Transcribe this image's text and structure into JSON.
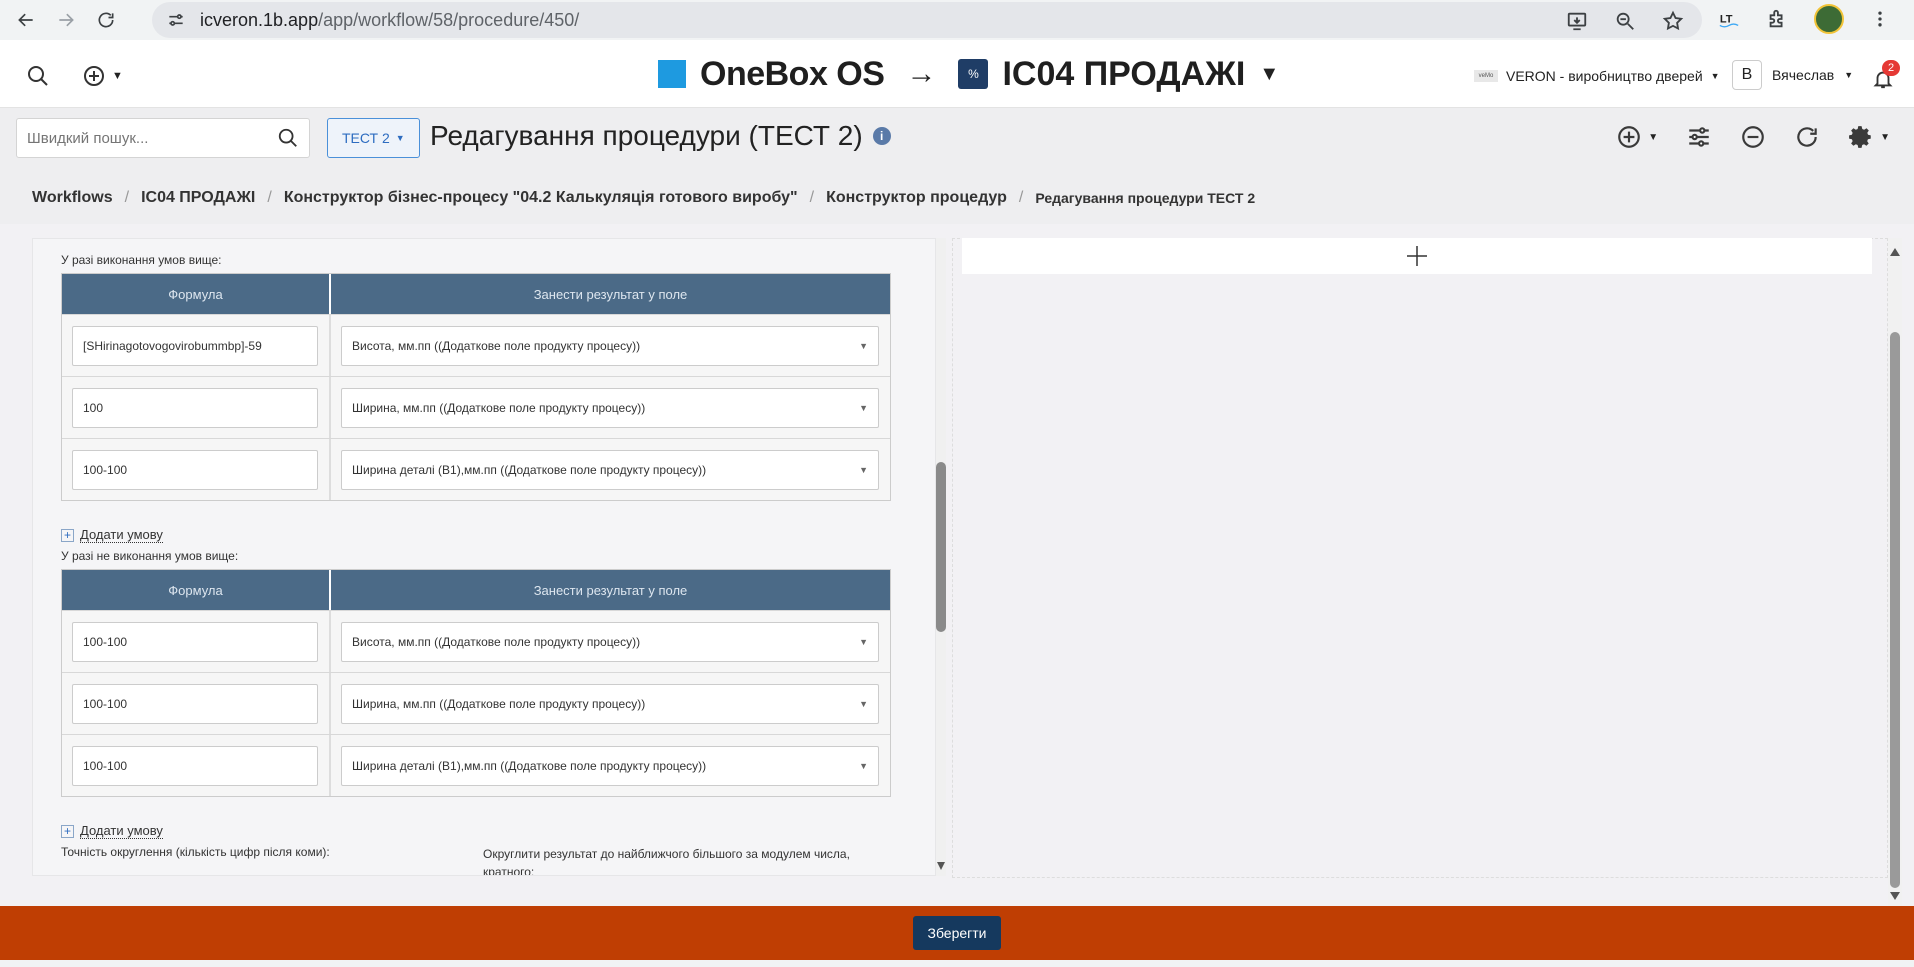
{
  "browser": {
    "url_domain": "icveron.1b.app",
    "url_path": "/app/workflow/58/procedure/450/"
  },
  "header": {
    "brand_name": "OneBox OS",
    "arrow": "→",
    "subsystem": "IC04 ПРОДАЖІ",
    "company": "VERON - виробництво дверей",
    "company_logo_text": "veMo",
    "user_initial": "В",
    "user_name": "Вячеслав",
    "notifications_count": "2"
  },
  "toolbar": {
    "search_placeholder": "Швидкий пошук...",
    "test_button": "ТЕСТ 2",
    "page_title": "Редагування процедури (ТЕСТ 2)",
    "info_glyph": "i"
  },
  "breadcrumbs": [
    "Workflows",
    "IC04 ПРОДАЖІ",
    "Конструктор бізнес-процесу \"04.2 Калькуляція готового виробу\"",
    "Конструктор процедур",
    "Редагування процедури ТЕСТ 2"
  ],
  "breadcrumb_sep": "/",
  "conditions": {
    "when_met_label": "У разі виконання умов вище:",
    "when_not_met_label": "У разі не виконання умов вище:",
    "col_formula": "Формула",
    "col_result": "Занести результат у поле",
    "add_condition": "Додати умову",
    "met_rows": [
      {
        "formula": "[SHirinagotovogovirobummbp]-59",
        "field": "Висота, мм.пп ((Додаткове поле продукту процесу))"
      },
      {
        "formula": "100",
        "field": "Ширина, мм.пп ((Додаткове поле продукту процесу))"
      },
      {
        "formula": "100-100",
        "field": "Ширина деталі (В1),мм.пп ((Додаткове поле продукту процесу))"
      }
    ],
    "not_met_rows": [
      {
        "formula": "100-100",
        "field": "Висота, мм.пп ((Додаткове поле продукту процесу))"
      },
      {
        "formula": "100-100",
        "field": "Ширина, мм.пп ((Додаткове поле продукту процесу))"
      },
      {
        "formula": "100-100",
        "field": "Ширина деталі (В1),мм.пп ((Додаткове поле продукту процесу))"
      }
    ],
    "precision_label": "Точність округлення (кількість цифр після коми):",
    "round_label": "Округлити результат до найближчого більшого за модулем числа, кратного:"
  },
  "footer": {
    "save_label": "Зберегти"
  }
}
